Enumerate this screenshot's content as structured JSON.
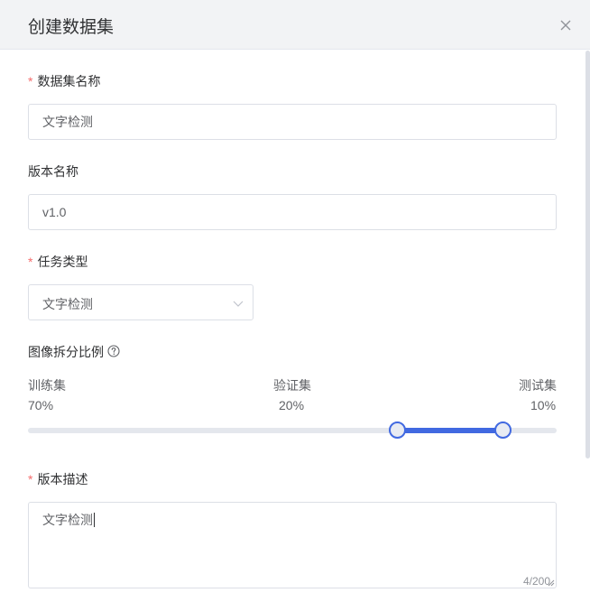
{
  "dialog": {
    "title": "创建数据集",
    "close_icon": "close-icon"
  },
  "form": {
    "dataset_name": {
      "label": "数据集名称",
      "required_mark": "*",
      "value": "文字检测"
    },
    "version_name": {
      "label": "版本名称",
      "value": "v1.0"
    },
    "task_type": {
      "label": "任务类型",
      "required_mark": "*",
      "value": "文字检测",
      "icon": "chevron-down-icon"
    },
    "split_ratio": {
      "label": "图像拆分比例",
      "help_icon": "question-circle-icon",
      "train": {
        "name": "训练集",
        "percent": "70%"
      },
      "validation": {
        "name": "验证集",
        "percent": "20%"
      },
      "test": {
        "name": "测试集",
        "percent": "10%"
      },
      "slider": {
        "handle_low": 0.7,
        "handle_high": 0.9,
        "accent": "#4169e1"
      }
    },
    "version_desc": {
      "label": "版本描述",
      "required_mark": "*",
      "value": "文字检测",
      "counter": "4/200"
    }
  },
  "colors": {
    "required": "#f56c6c",
    "accent": "#4169e1",
    "header_bg": "#f2f3f5"
  }
}
